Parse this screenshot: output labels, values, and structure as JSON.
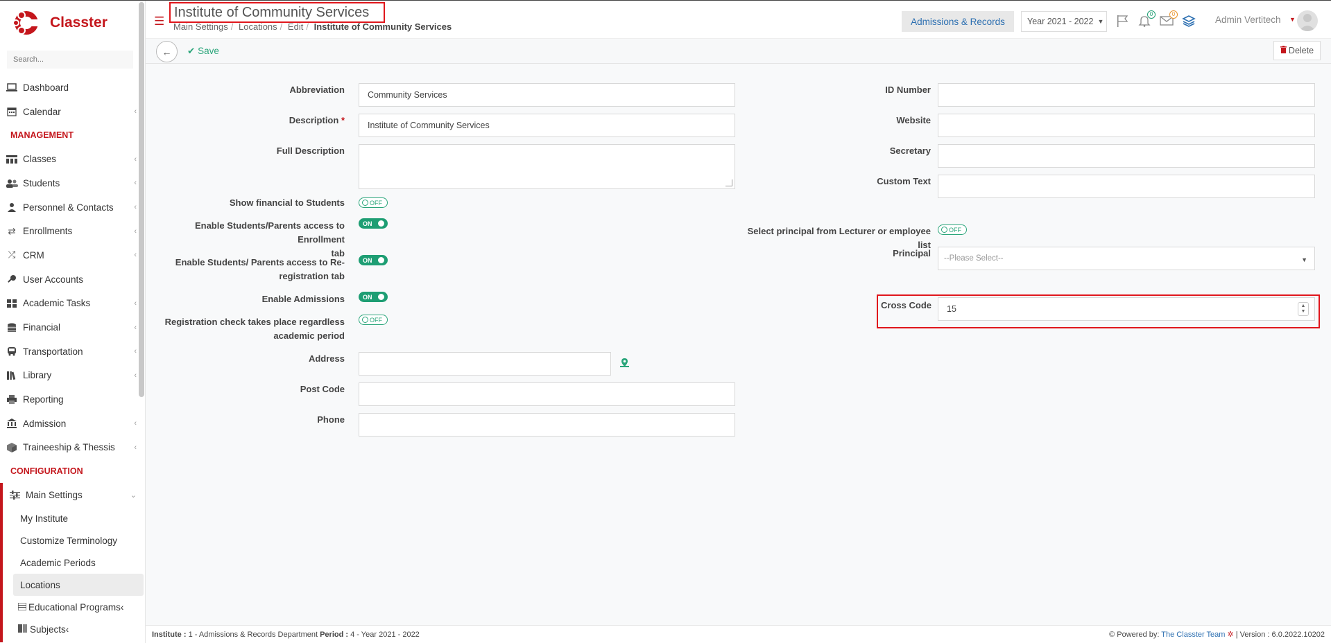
{
  "app": {
    "name": "Classter"
  },
  "sidebar": {
    "search_placeholder": "Search...",
    "items_top": [
      {
        "label": "Dashboard",
        "icon": "laptop-icon"
      },
      {
        "label": "Calendar",
        "icon": "calendar-icon"
      }
    ],
    "section_management": "MANAGEMENT",
    "items_management": [
      {
        "label": "Classes",
        "icon": "classes-icon"
      },
      {
        "label": "Students",
        "icon": "students-icon"
      },
      {
        "label": "Personnel & Contacts",
        "icon": "personnel-icon"
      },
      {
        "label": "Enrollments",
        "icon": "transfer-icon"
      },
      {
        "label": "CRM",
        "icon": "crm-icon"
      },
      {
        "label": "User Accounts",
        "icon": "key-icon"
      },
      {
        "label": "Academic Tasks",
        "icon": "grid-icon"
      },
      {
        "label": "Financial",
        "icon": "coins-icon"
      },
      {
        "label": "Transportation",
        "icon": "bus-icon"
      },
      {
        "label": "Library",
        "icon": "books-icon"
      },
      {
        "label": "Reporting",
        "icon": "printer-icon"
      },
      {
        "label": "Admission",
        "icon": "institution-icon"
      },
      {
        "label": "Traineeship & Thessis",
        "icon": "box-icon"
      }
    ],
    "section_configuration": "CONFIGURATION",
    "main_settings": "Main Settings",
    "sub_items": [
      {
        "label": "My Institute"
      },
      {
        "label": "Customize Terminology"
      },
      {
        "label": "Academic Periods"
      },
      {
        "label": "Locations"
      },
      {
        "label": "Educational Programs"
      },
      {
        "label": "Subjects"
      }
    ]
  },
  "header": {
    "title": "Institute of Community Services",
    "breadcrumb": [
      "Main Settings",
      "Locations",
      "Edit",
      "Institute of Community Services"
    ],
    "department_button": "Admissions & Records",
    "year_selector": "Year 2021 - 2022",
    "notifications_count": "0",
    "messages_count": "0",
    "user_name": "Admin Vertitech"
  },
  "toolbar": {
    "save_label": "Save",
    "delete_label": "Delete"
  },
  "form": {
    "abbreviation_label": "Abbreviation",
    "abbreviation_value": "Community Services",
    "description_label": "Description",
    "description_required": "*",
    "description_value": "Institute of Community Services",
    "full_description_label": "Full Description",
    "full_description_value": "",
    "show_financial_label": "Show financial to Students",
    "show_financial_state": "OFF",
    "enrollment_access_label_1": "Enable Students/Parents access to Enrollment",
    "enrollment_access_label_2": "tab",
    "enrollment_access_state": "ON",
    "reregistration_label_1": "Enable Students/ Parents access to Re-",
    "reregistration_label_2": "registration tab",
    "reregistration_state": "ON",
    "enable_admissions_label": "Enable Admissions",
    "enable_admissions_state": "ON",
    "registration_check_label_1": "Registration check takes place regardless",
    "registration_check_label_2": "academic period",
    "registration_check_state": "OFF",
    "address_label": "Address",
    "post_code_label": "Post Code",
    "phone_label": "Phone",
    "id_number_label": "ID Number",
    "website_label": "Website",
    "secretary_label": "Secretary",
    "custom_text_label": "Custom Text",
    "select_principal_label": "Select principal from Lecturer or employee list",
    "select_principal_state": "OFF",
    "principal_label": "Principal",
    "principal_placeholder": "--Please Select--",
    "cross_code_label": "Cross Code",
    "cross_code_value": "15"
  },
  "footer": {
    "institute_label": "Institute :",
    "institute_value": "1 - Admissions & Records Department",
    "period_label": "Period :",
    "period_value": "4 - Year 2021 - 2022",
    "powered_by": "Powered by:",
    "team": "The Classter Team",
    "version": "| Version : 6.0.2022.10202"
  },
  "colors": {
    "brand": "#c4161c",
    "accent_green": "#1e9e73",
    "link_blue": "#2c6fb1",
    "highlight_red": "#e0161c"
  }
}
